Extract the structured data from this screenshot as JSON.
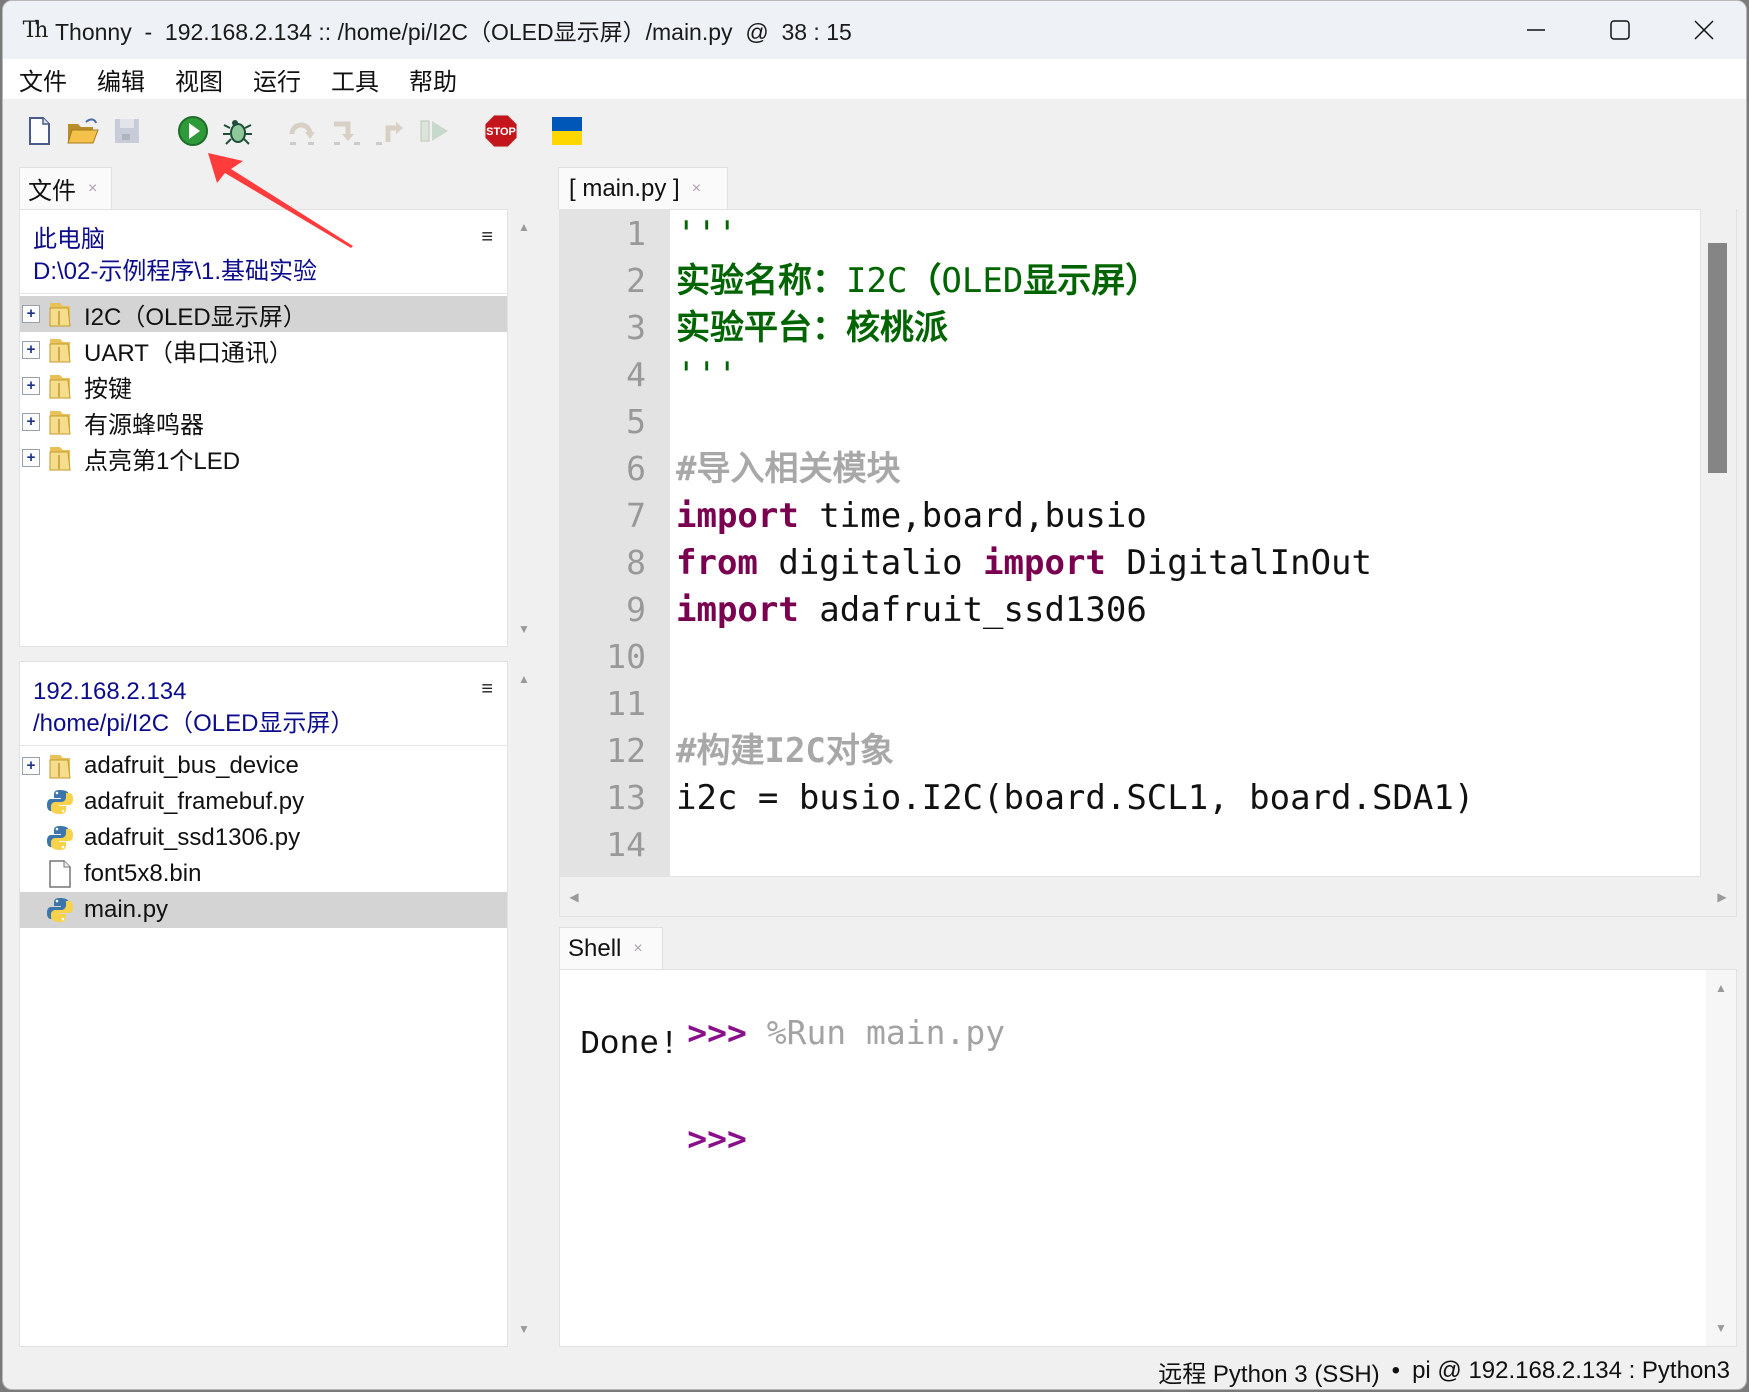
{
  "window": {
    "app_icon": "Th",
    "title": "Thonny  -  192.168.2.134 :: /home/pi/I2C（OLED显示屏）/main.py  @  38 : 15",
    "controls": {
      "minimize": "—",
      "maximize": "☐",
      "close": "✕"
    }
  },
  "menu": [
    "文件",
    "编辑",
    "视图",
    "运行",
    "工具",
    "帮助"
  ],
  "toolbar": {
    "buttons": [
      {
        "name": "new-file",
        "icon": "new-file-icon",
        "enabled": true
      },
      {
        "name": "open-file",
        "icon": "open-folder-icon",
        "enabled": true
      },
      {
        "name": "save-file",
        "icon": "save-icon",
        "enabled": false
      },
      {
        "name": "run",
        "icon": "run-icon",
        "enabled": true
      },
      {
        "name": "debug",
        "icon": "bug-icon",
        "enabled": true
      },
      {
        "name": "step-over",
        "icon": "step-over-icon",
        "enabled": false
      },
      {
        "name": "step-into",
        "icon": "step-into-icon",
        "enabled": false
      },
      {
        "name": "step-out",
        "icon": "step-out-icon",
        "enabled": false
      },
      {
        "name": "resume",
        "icon": "resume-icon",
        "enabled": false
      },
      {
        "name": "stop",
        "icon": "stop-icon",
        "label": "STOP",
        "enabled": true
      },
      {
        "name": "support-ukraine",
        "icon": "ukraine-flag-icon",
        "enabled": true
      }
    ],
    "annotation_color": "#ff3b3b"
  },
  "files_panel": {
    "tab_label": "文件",
    "tab_close": "×",
    "local": {
      "location": "此电脑",
      "path": "D:\\02-示例程序\\1.基础实验",
      "menu_glyph": "≡",
      "items": [
        {
          "label": "I2C（OLED显示屏）",
          "type": "folder",
          "expandable": true,
          "selected": true
        },
        {
          "label": "UART（串口通讯）",
          "type": "folder",
          "expandable": true,
          "selected": false
        },
        {
          "label": "按键",
          "type": "folder",
          "expandable": true,
          "selected": false
        },
        {
          "label": "有源蜂鸣器",
          "type": "folder",
          "expandable": true,
          "selected": false
        },
        {
          "label": "点亮第1个LED",
          "type": "folder",
          "expandable": true,
          "selected": false
        }
      ]
    },
    "remote": {
      "location": "192.168.2.134",
      "path": "/home/pi/I2C（OLED显示屏）",
      "menu_glyph": "≡",
      "items": [
        {
          "label": "adafruit_bus_device",
          "type": "folder",
          "expandable": true,
          "selected": false
        },
        {
          "label": "adafruit_framebuf.py",
          "type": "python",
          "expandable": false,
          "selected": false
        },
        {
          "label": "adafruit_ssd1306.py",
          "type": "python",
          "expandable": false,
          "selected": false
        },
        {
          "label": "font5x8.bin",
          "type": "file",
          "expandable": false,
          "selected": false
        },
        {
          "label": "main.py",
          "type": "python",
          "expandable": false,
          "selected": true
        }
      ]
    }
  },
  "editor": {
    "tab_label": "[ main.py ]",
    "tab_close": "×",
    "lines": [
      {
        "n": "1",
        "tokens": [
          {
            "t": "'''",
            "c": "str"
          }
        ]
      },
      {
        "n": "2",
        "tokens": [
          {
            "t": "实验名称：",
            "c": "strb"
          },
          {
            "t": "I2C",
            "c": "str"
          },
          {
            "t": "（",
            "c": "strb"
          },
          {
            "t": "OLED",
            "c": "str"
          },
          {
            "t": "显示屏）",
            "c": "strb"
          }
        ]
      },
      {
        "n": "3",
        "tokens": [
          {
            "t": "实验平台：核桃派",
            "c": "strb"
          }
        ]
      },
      {
        "n": "4",
        "tokens": [
          {
            "t": "'''",
            "c": "str"
          }
        ]
      },
      {
        "n": "5",
        "tokens": []
      },
      {
        "n": "6",
        "tokens": [
          {
            "t": "#导入相关模块",
            "c": "cmt"
          }
        ]
      },
      {
        "n": "7",
        "tokens": [
          {
            "t": "import",
            "c": "kw"
          },
          {
            "t": " time,board,busio",
            "c": ""
          }
        ]
      },
      {
        "n": "8",
        "tokens": [
          {
            "t": "from",
            "c": "kw"
          },
          {
            "t": " digitalio ",
            "c": ""
          },
          {
            "t": "import",
            "c": "kw"
          },
          {
            "t": " DigitalInOut",
            "c": ""
          }
        ]
      },
      {
        "n": "9",
        "tokens": [
          {
            "t": "import",
            "c": "kw"
          },
          {
            "t": " adafruit_ssd1306",
            "c": ""
          }
        ]
      },
      {
        "n": "10",
        "tokens": []
      },
      {
        "n": "11",
        "tokens": []
      },
      {
        "n": "12",
        "tokens": [
          {
            "t": "#构建I2C对象",
            "c": "cmt"
          }
        ]
      },
      {
        "n": "13",
        "tokens": [
          {
            "t": "i2c = busio.I2C(board.SCL1, board.SDA1)",
            "c": ""
          }
        ]
      },
      {
        "n": "14",
        "tokens": []
      }
    ]
  },
  "shell": {
    "tab_label": "Shell",
    "tab_close": "×",
    "prompt": ">>>",
    "command": "%Run main.py",
    "output": "Done!"
  },
  "statusbar": {
    "interpreter": "远程 Python 3 (SSH)",
    "separator": "•",
    "connection": "pi @ 192.168.2.134 : Python3"
  }
}
